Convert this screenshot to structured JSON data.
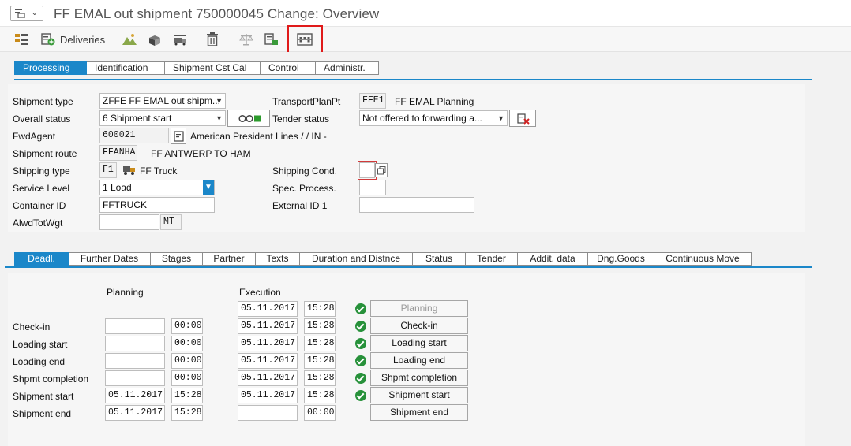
{
  "title": "FF EMAL out shipment 750000045 Change: Overview",
  "toolbar": {
    "deliveries_label": "Deliveries"
  },
  "top_tabs": [
    "Processing",
    "Identification",
    "Shipment Cst Cal",
    "Control",
    "Administr."
  ],
  "header": {
    "shipment_type_label": "Shipment type",
    "shipment_type_value": "ZFFE FF EMAL out shipm...",
    "overall_status_label": "Overall status",
    "overall_status_value": "6 Shipment start",
    "fwd_agent_label": "FwdAgent",
    "fwd_agent_value": "600021",
    "fwd_agent_text": "American President Lines /  / IN -",
    "shipment_route_label": "Shipment route",
    "shipment_route_value": "FFANHA",
    "shipment_route_text": "FF ANTWERP TO HAM",
    "shipping_type_label": "Shipping type",
    "shipping_type_value": "F1",
    "shipping_type_text": "FF Truck",
    "service_level_label": "Service Level",
    "service_level_value": "1 Load",
    "container_id_label": "Container ID",
    "container_id_value": "FFTRUCK",
    "alwd_tot_wgt_label": "AlwdTotWgt",
    "alwd_tot_wgt_value": "",
    "alwd_tot_wgt_unit": "MT",
    "transport_plan_pt_label": "TransportPlanPt",
    "transport_plan_pt_value": "FFE1",
    "transport_plan_pt_text": "FF EMAL Planning",
    "tender_status_label": "Tender status",
    "tender_status_value": "Not offered to forwarding a...",
    "shipping_cond_label": "Shipping Cond.",
    "shipping_cond_value": "",
    "spec_process_label": "Spec. Process.",
    "spec_process_value": "",
    "external_id_label": "External ID 1",
    "external_id_value": ""
  },
  "bottom_tabs": [
    "Deadl.",
    "Further Dates",
    "Stages",
    "Partner",
    "Texts",
    "Duration and Distnce",
    "Status",
    "Tender",
    "Addit. data",
    "Dng.Goods",
    "Continuous Move"
  ],
  "deadlines": {
    "planning_header": "Planning",
    "execution_header": "Execution",
    "top_execution": {
      "date": "05.11.2017",
      "time": "15:28",
      "button": "Planning"
    },
    "rows": [
      {
        "label": "Check-in",
        "plan_date": "",
        "plan_time": "00:00",
        "exec_date": "05.11.2017",
        "exec_time": "15:28",
        "button": "Check-in"
      },
      {
        "label": "Loading start",
        "plan_date": "",
        "plan_time": "00:00",
        "exec_date": "05.11.2017",
        "exec_time": "15:28",
        "button": "Loading start"
      },
      {
        "label": "Loading end",
        "plan_date": "",
        "plan_time": "00:00",
        "exec_date": "05.11.2017",
        "exec_time": "15:28",
        "button": "Loading end"
      },
      {
        "label": "Shpmt completion",
        "plan_date": "",
        "plan_time": "00:00",
        "exec_date": "05.11.2017",
        "exec_time": "15:28",
        "button": "Shpmt completion"
      },
      {
        "label": "Shipment start",
        "plan_date": "05.11.2017",
        "plan_time": "15:28",
        "exec_date": "05.11.2017",
        "exec_time": "15:28",
        "button": "Shipment start"
      },
      {
        "label": "Shipment end",
        "plan_date": "05.11.2017",
        "plan_time": "15:28",
        "exec_date": "",
        "exec_time": "00:00",
        "button": "Shipment end"
      }
    ]
  },
  "colors": {
    "accent": "#1b87c9",
    "highlight": "#e01a1a",
    "ok": "#27913a"
  }
}
